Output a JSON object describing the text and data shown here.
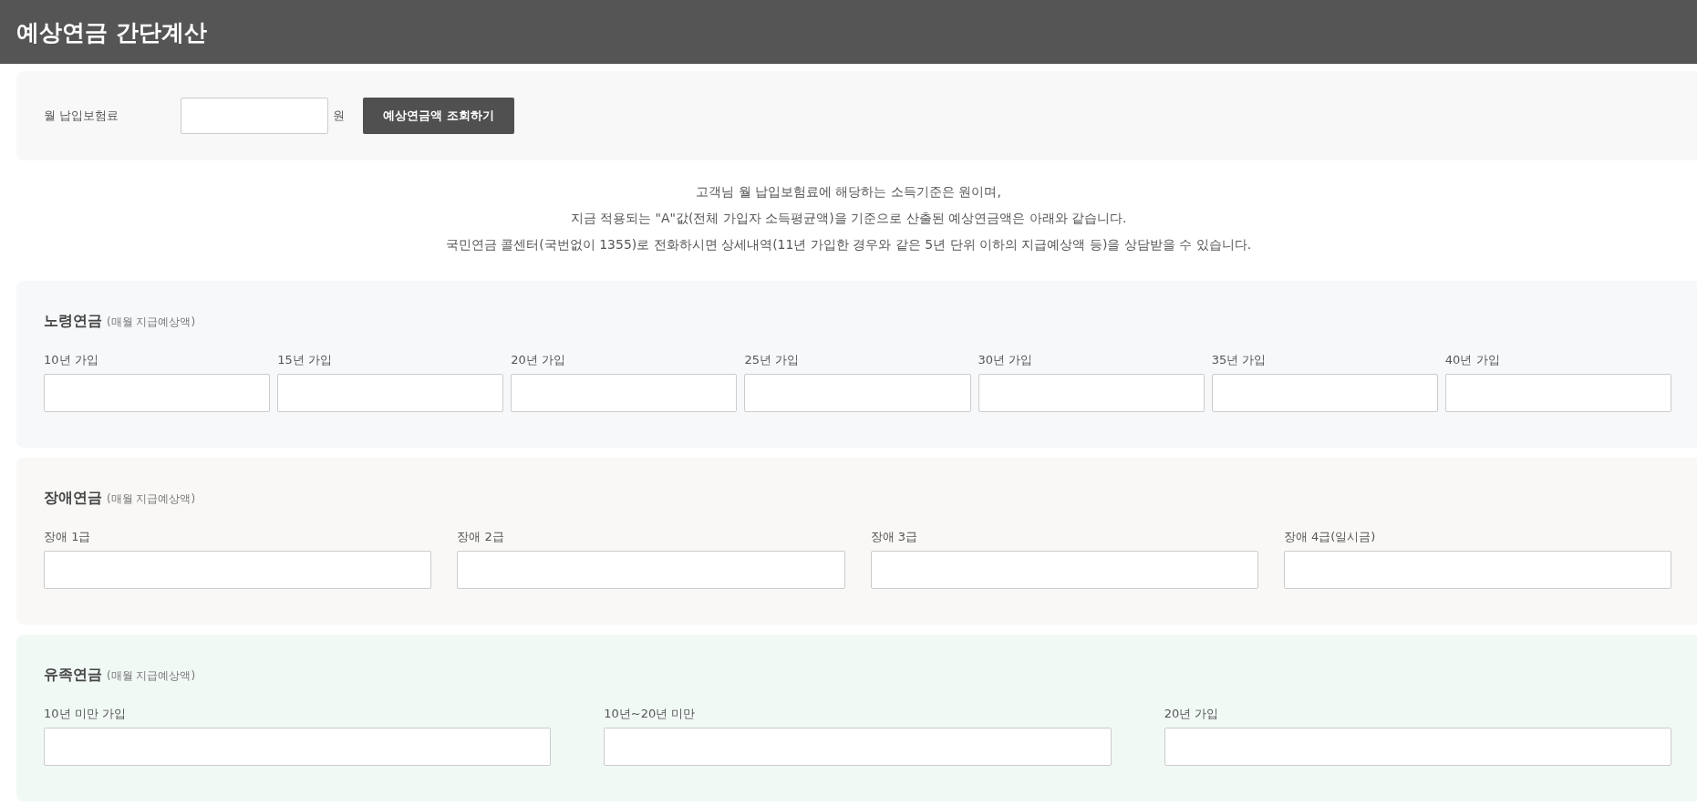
{
  "header": {
    "title": "예상연금 간단계산"
  },
  "query": {
    "label": "월 납입보험료",
    "unit": "원",
    "button": "예상연금액 조회하기"
  },
  "notice": [
    "고객님 월 납입보험료에 해당하는 소득기준은 원이며,",
    "지금 적용되는 \"A\"값(전체 가입자 소득평균액)을 기준으로 산출된 예상연금액은 아래와 같습니다.",
    "국민연금 콜센터(국번없이 1355)로 전화하시면 상세내역(11년 가입한 경우와 같은 5년 단위 이하의 지급예상액 등)을 상담받을 수 있습니다."
  ],
  "sections": [
    {
      "title": "노령연금",
      "subtitle": "(매월 지급예상액)",
      "color": "#f7f8fa",
      "fields": [
        "10년 가입",
        "15년 가입",
        "20년 가입",
        "25년 가입",
        "30년 가입",
        "35년 가입",
        "40년 가입"
      ]
    },
    {
      "title": "장애연금",
      "subtitle": "(매월 지급예상액)",
      "color": "#f9f8f7",
      "fields": [
        "장애 1급",
        "장애 2급",
        "장애 3급",
        "장애 4급(일시금)"
      ]
    },
    {
      "title": "유족연금",
      "subtitle": "(매월 지급예상액)",
      "color": "#f1f9f5",
      "fields": [
        "10년 미만 가입",
        "10년~20년 미만",
        "20년 가입"
      ]
    }
  ]
}
